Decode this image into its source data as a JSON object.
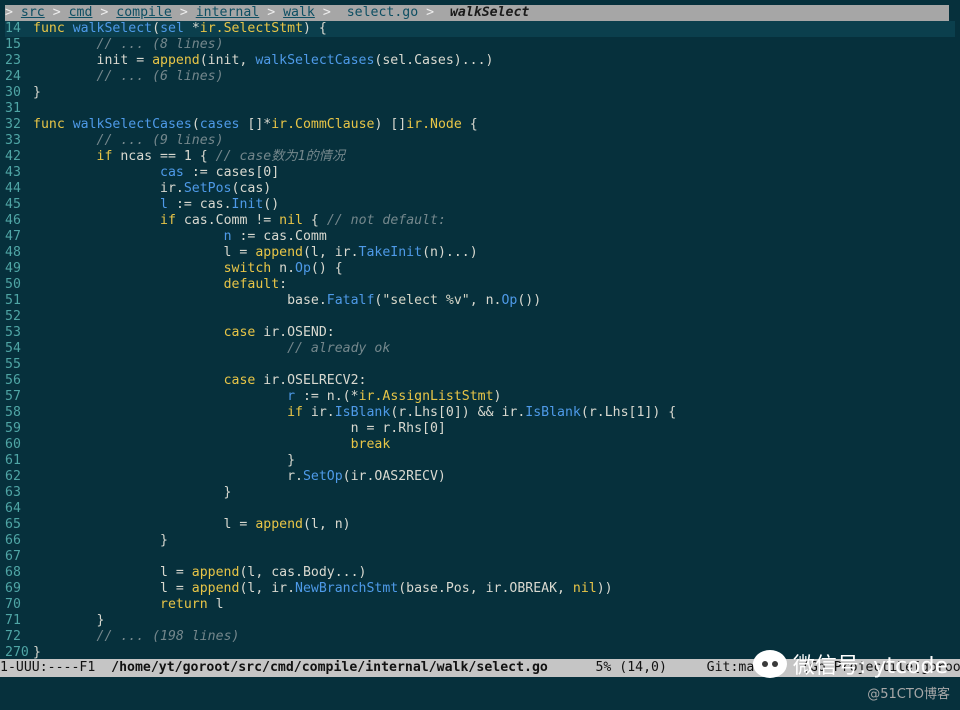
{
  "breadcrumb": {
    "lead": ">",
    "segments": [
      "src",
      "cmd",
      "compile",
      "internal",
      "walk"
    ],
    "current": "select.go",
    "function": "walkSelect"
  },
  "code_lines": [
    {
      "n": "14",
      "current": true,
      "tokens": [
        {
          "t": "func",
          "c": "kw"
        },
        {
          "t": " "
        },
        {
          "t": "walkSelect",
          "c": "fn"
        },
        {
          "t": "("
        },
        {
          "t": "sel",
          "c": "var"
        },
        {
          "t": " *"
        },
        {
          "t": "ir.SelectStmt",
          "c": "ty"
        },
        {
          "t": ") {"
        }
      ]
    },
    {
      "n": "15",
      "tokens": [
        {
          "t": "        "
        },
        {
          "t": "// ... (8 lines)",
          "c": "cm"
        }
      ]
    },
    {
      "n": "23",
      "tokens": [
        {
          "t": "        init = "
        },
        {
          "t": "append",
          "c": "kw"
        },
        {
          "t": "(init, "
        },
        {
          "t": "walkSelectCases",
          "c": "fn"
        },
        {
          "t": "(sel.Cases)...)"
        }
      ]
    },
    {
      "n": "24",
      "tokens": [
        {
          "t": "        "
        },
        {
          "t": "// ... (6 lines)",
          "c": "cm"
        }
      ]
    },
    {
      "n": "30",
      "tokens": [
        {
          "t": "}"
        }
      ]
    },
    {
      "n": "31",
      "tokens": []
    },
    {
      "n": "32",
      "tokens": [
        {
          "t": "func",
          "c": "kw"
        },
        {
          "t": " "
        },
        {
          "t": "walkSelectCases",
          "c": "fn"
        },
        {
          "t": "("
        },
        {
          "t": "cases",
          "c": "var"
        },
        {
          "t": " []*"
        },
        {
          "t": "ir.CommClause",
          "c": "ty"
        },
        {
          "t": ") []"
        },
        {
          "t": "ir.Node",
          "c": "ty"
        },
        {
          "t": " {"
        }
      ]
    },
    {
      "n": "33",
      "tokens": [
        {
          "t": "        "
        },
        {
          "t": "// ... (9 lines)",
          "c": "cm"
        }
      ]
    },
    {
      "n": "42",
      "tokens": [
        {
          "t": "        "
        },
        {
          "t": "if",
          "c": "kw"
        },
        {
          "t": " ncas == 1 { "
        },
        {
          "t": "// case数为1的情况",
          "c": "cm"
        }
      ]
    },
    {
      "n": "43",
      "tokens": [
        {
          "t": "                "
        },
        {
          "t": "cas",
          "c": "var"
        },
        {
          "t": " := cases[0]"
        }
      ]
    },
    {
      "n": "44",
      "tokens": [
        {
          "t": "                ir."
        },
        {
          "t": "SetPos",
          "c": "fn"
        },
        {
          "t": "(cas)"
        }
      ]
    },
    {
      "n": "45",
      "tokens": [
        {
          "t": "                "
        },
        {
          "t": "l",
          "c": "var"
        },
        {
          "t": " := cas."
        },
        {
          "t": "Init",
          "c": "fn"
        },
        {
          "t": "()"
        }
      ]
    },
    {
      "n": "46",
      "tokens": [
        {
          "t": "                "
        },
        {
          "t": "if",
          "c": "kw"
        },
        {
          "t": " cas.Comm != "
        },
        {
          "t": "nil",
          "c": "kw"
        },
        {
          "t": " { "
        },
        {
          "t": "// not default:",
          "c": "cm"
        }
      ]
    },
    {
      "n": "47",
      "tokens": [
        {
          "t": "                        "
        },
        {
          "t": "n",
          "c": "var"
        },
        {
          "t": " := cas.Comm"
        }
      ]
    },
    {
      "n": "48",
      "tokens": [
        {
          "t": "                        l = "
        },
        {
          "t": "append",
          "c": "kw"
        },
        {
          "t": "(l, ir."
        },
        {
          "t": "TakeInit",
          "c": "fn"
        },
        {
          "t": "(n)...)"
        }
      ]
    },
    {
      "n": "49",
      "tokens": [
        {
          "t": "                        "
        },
        {
          "t": "switch",
          "c": "kw"
        },
        {
          "t": " n."
        },
        {
          "t": "Op",
          "c": "fn"
        },
        {
          "t": "() {"
        }
      ]
    },
    {
      "n": "50",
      "tokens": [
        {
          "t": "                        "
        },
        {
          "t": "default",
          "c": "kw"
        },
        {
          "t": ":"
        }
      ]
    },
    {
      "n": "51",
      "tokens": [
        {
          "t": "                                base."
        },
        {
          "t": "Fatalf",
          "c": "fn"
        },
        {
          "t": "("
        },
        {
          "t": "\"select %v\"",
          "c": "st"
        },
        {
          "t": ", n."
        },
        {
          "t": "Op",
          "c": "fn"
        },
        {
          "t": "())"
        }
      ]
    },
    {
      "n": "52",
      "tokens": []
    },
    {
      "n": "53",
      "tokens": [
        {
          "t": "                        "
        },
        {
          "t": "case",
          "c": "kw"
        },
        {
          "t": " ir.OSEND:"
        }
      ]
    },
    {
      "n": "54",
      "tokens": [
        {
          "t": "                                "
        },
        {
          "t": "// already ok",
          "c": "cm"
        }
      ]
    },
    {
      "n": "55",
      "tokens": []
    },
    {
      "n": "56",
      "tokens": [
        {
          "t": "                        "
        },
        {
          "t": "case",
          "c": "kw"
        },
        {
          "t": " ir.OSELRECV2:"
        }
      ]
    },
    {
      "n": "57",
      "tokens": [
        {
          "t": "                                "
        },
        {
          "t": "r",
          "c": "var"
        },
        {
          "t": " := n.(*"
        },
        {
          "t": "ir.AssignListStmt",
          "c": "ty"
        },
        {
          "t": ")"
        }
      ]
    },
    {
      "n": "58",
      "tokens": [
        {
          "t": "                                "
        },
        {
          "t": "if",
          "c": "kw"
        },
        {
          "t": " ir."
        },
        {
          "t": "IsBlank",
          "c": "fn"
        },
        {
          "t": "(r.Lhs[0]) && ir."
        },
        {
          "t": "IsBlank",
          "c": "fn"
        },
        {
          "t": "(r.Lhs[1]) {"
        }
      ]
    },
    {
      "n": "59",
      "tokens": [
        {
          "t": "                                        n = r.Rhs[0]"
        }
      ]
    },
    {
      "n": "60",
      "tokens": [
        {
          "t": "                                        "
        },
        {
          "t": "break",
          "c": "kw"
        }
      ]
    },
    {
      "n": "61",
      "tokens": [
        {
          "t": "                                }"
        }
      ]
    },
    {
      "n": "62",
      "tokens": [
        {
          "t": "                                r."
        },
        {
          "t": "SetOp",
          "c": "fn"
        },
        {
          "t": "(ir.OAS2RECV)"
        }
      ]
    },
    {
      "n": "63",
      "tokens": [
        {
          "t": "                        }"
        }
      ]
    },
    {
      "n": "64",
      "tokens": []
    },
    {
      "n": "65",
      "tokens": [
        {
          "t": "                        l = "
        },
        {
          "t": "append",
          "c": "kw"
        },
        {
          "t": "(l, n)"
        }
      ]
    },
    {
      "n": "66",
      "tokens": [
        {
          "t": "                }"
        }
      ]
    },
    {
      "n": "67",
      "tokens": []
    },
    {
      "n": "68",
      "tokens": [
        {
          "t": "                l = "
        },
        {
          "t": "append",
          "c": "kw"
        },
        {
          "t": "(l, cas.Body...)"
        }
      ]
    },
    {
      "n": "69",
      "tokens": [
        {
          "t": "                l = "
        },
        {
          "t": "append",
          "c": "kw"
        },
        {
          "t": "(l, ir."
        },
        {
          "t": "NewBranchStmt",
          "c": "fn"
        },
        {
          "t": "(base.Pos, ir.OBREAK, "
        },
        {
          "t": "nil",
          "c": "kw"
        },
        {
          "t": "))"
        }
      ]
    },
    {
      "n": "70",
      "tokens": [
        {
          "t": "                "
        },
        {
          "t": "return",
          "c": "kw"
        },
        {
          "t": " l"
        }
      ]
    },
    {
      "n": "71",
      "tokens": [
        {
          "t": "        }"
        }
      ]
    },
    {
      "n": "72",
      "tokens": [
        {
          "t": "        "
        },
        {
          "t": "// ... (198 lines)",
          "c": "cm"
        }
      ]
    },
    {
      "n": "270",
      "tokens": [
        {
          "t": "}"
        }
      ]
    }
  ],
  "modeline": {
    "status": "1-UUU:----F1  ",
    "path": "/home/yt/goroot/src/cmd/compile/internal/walk/select.go",
    "position": "5% (14,0)",
    "git": "Git:master  (Go Projectile[goroot] ElDoc Proje"
  },
  "watermark": {
    "text": "微信号: ytcode",
    "site": "@51CTO博客"
  },
  "colors": {
    "background": "#06303c",
    "keyword": "#e8c547",
    "function": "#4e9ae8",
    "comment": "#74878c",
    "line_number": "#4fa5a5"
  }
}
